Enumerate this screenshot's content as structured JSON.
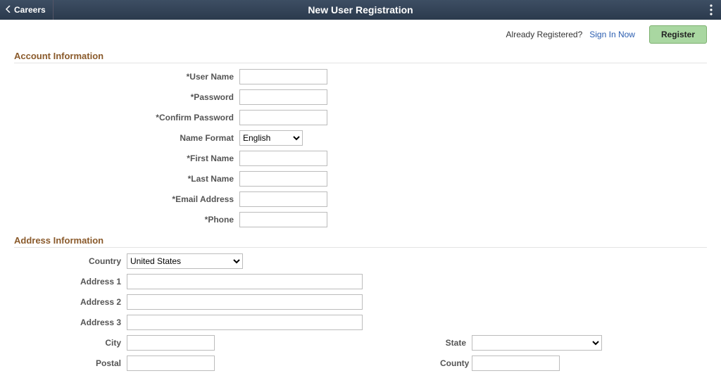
{
  "header": {
    "back_label": "Careers",
    "title": "New User Registration"
  },
  "topbar": {
    "already_label": "Already Registered?",
    "signin_label": "Sign In Now",
    "register_label": "Register"
  },
  "section_account": {
    "title": "Account Information",
    "fields": {
      "username": "*User Name",
      "password": "*Password",
      "confirm_password": "*Confirm Password",
      "name_format": "Name Format",
      "name_format_value": "English",
      "first_name": "*First Name",
      "last_name": "*Last Name",
      "email": "*Email Address",
      "phone": "*Phone"
    }
  },
  "section_address": {
    "title": "Address Information",
    "fields": {
      "country": "Country",
      "country_value": "United States",
      "address1": "Address 1",
      "address2": "Address 2",
      "address3": "Address 3",
      "city": "City",
      "state": "State",
      "postal": "Postal",
      "county": "County"
    }
  }
}
